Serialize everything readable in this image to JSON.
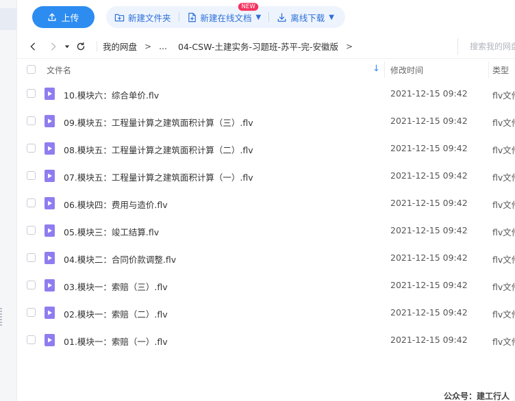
{
  "toolbar": {
    "upload_label": "上传",
    "new_folder_label": "新建文件夹",
    "new_online_doc_label": "新建在线文档",
    "new_badge": "NEW",
    "offline_download_label": "离线下载"
  },
  "nav": {
    "breadcrumb_root": "我的网盘",
    "breadcrumb_sep": ">",
    "breadcrumb_ellipsis": "...",
    "breadcrumb_current": "04-CSW-土建实务-习题班-苏平-完-安徽版",
    "search_placeholder": "搜索我的网盘"
  },
  "table": {
    "headers": {
      "name": "文件名",
      "modified": "修改时间",
      "type": "类型"
    },
    "rows": [
      {
        "name": "10.模块六：综合单价.flv",
        "modified": "2021-12-15 09:42",
        "type": "flv文件"
      },
      {
        "name": "09.模块五：工程量计算之建筑面积计算（三）.flv",
        "modified": "2021-12-15 09:42",
        "type": "flv文件"
      },
      {
        "name": "08.模块五：工程量计算之建筑面积计算（二）.flv",
        "modified": "2021-12-15 09:42",
        "type": "flv文件"
      },
      {
        "name": "07.模块五：工程量计算之建筑面积计算（一）.flv",
        "modified": "2021-12-15 09:42",
        "type": "flv文件"
      },
      {
        "name": "06.模块四：费用与造价.flv",
        "modified": "2021-12-15 09:42",
        "type": "flv文件"
      },
      {
        "name": "05.模块三：竣工结算.flv",
        "modified": "2021-12-15 09:42",
        "type": "flv文件"
      },
      {
        "name": "04.模块二：合同价款调整.flv",
        "modified": "2021-12-15 09:42",
        "type": "flv文件"
      },
      {
        "name": "03.模块一：索赔（三）.flv",
        "modified": "2021-12-15 09:42",
        "type": "flv文件"
      },
      {
        "name": "02.模块一：索赔（二）.flv",
        "modified": "2021-12-15 09:42",
        "type": "flv文件"
      },
      {
        "name": "01.模块一：索赔（一）.flv",
        "modified": "2021-12-15 09:42",
        "type": "flv文件"
      }
    ]
  },
  "watermark": "公众号：建工行人",
  "colors": {
    "accent": "#2d8cf0",
    "video_icon": "#8f7df0",
    "badge": "#f5325e"
  }
}
